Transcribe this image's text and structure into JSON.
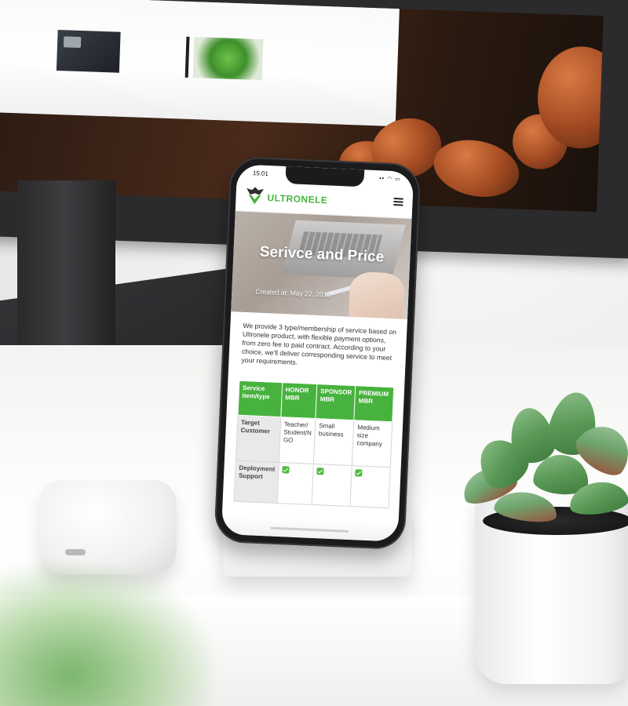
{
  "status": {
    "time": "15:01",
    "icons": "▪▪ ◠ ▭"
  },
  "app": {
    "brand": "ULTRONELE",
    "logo_icon": "ultronele-wing-logo-icon",
    "menu_icon": "hamburger-menu-icon",
    "accent": "#47b23d"
  },
  "hero": {
    "title": "Serivce and Price",
    "date": "Created at: May 22, 2019"
  },
  "intro": "We provide 3 type/membership of service based on Ultronele product, with flexible payment options, from zero fee to paid contract. According to your choice, we'll deliver corresponding service to meet your requirements.",
  "table": {
    "headers": [
      "Service item/type",
      "HONOR MBR",
      "SPONSOR MBR",
      "PREMIUM MBR"
    ],
    "rows": [
      {
        "label": "Target Customer",
        "cells": [
          "Teacher/ Student/N GO",
          "Small business",
          "Medium size company"
        ]
      },
      {
        "label": "Deployment Support",
        "cells": [
          "✅",
          "✅",
          "✅"
        ]
      }
    ]
  }
}
